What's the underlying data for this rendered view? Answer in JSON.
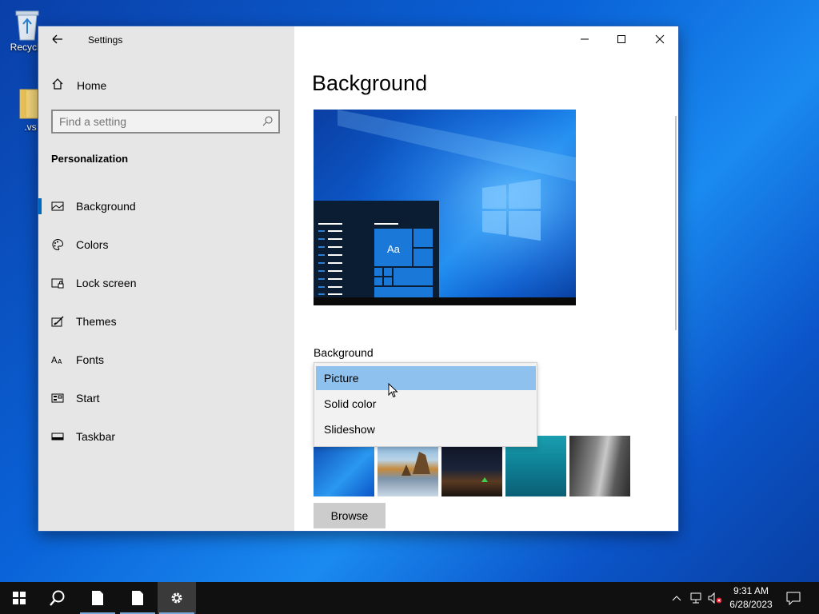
{
  "desktop": {
    "icons": [
      {
        "label": "Recycle",
        "icon": "recycle-bin-icon"
      },
      {
        "label": ".vs",
        "icon": "folder-icon"
      }
    ]
  },
  "window": {
    "title": "Settings",
    "controls": {
      "minimize": "minimize-icon",
      "maximize": "maximize-icon",
      "close": "close-icon"
    }
  },
  "sidebar": {
    "home_label": "Home",
    "search_placeholder": "Find a setting",
    "section_title": "Personalization",
    "items": [
      {
        "label": "Background",
        "icon": "picture-icon",
        "active": true
      },
      {
        "label": "Colors",
        "icon": "palette-icon",
        "active": false
      },
      {
        "label": "Lock screen",
        "icon": "lock-screen-icon",
        "active": false
      },
      {
        "label": "Themes",
        "icon": "themes-icon",
        "active": false
      },
      {
        "label": "Fonts",
        "icon": "fonts-icon",
        "active": false
      },
      {
        "label": "Start",
        "icon": "start-icon",
        "active": false
      },
      {
        "label": "Taskbar",
        "icon": "taskbar-icon",
        "active": false
      }
    ]
  },
  "main": {
    "page_title": "Background",
    "preview": {
      "tile_text": "Aa"
    },
    "background_label": "Background",
    "dropdown_options": [
      {
        "label": "Picture",
        "selected": true
      },
      {
        "label": "Solid color",
        "selected": false
      },
      {
        "label": "Slideshow",
        "selected": false
      }
    ],
    "browse_label": "Browse"
  },
  "taskbar": {
    "time": "9:31 AM",
    "date": "6/28/2023",
    "apps": [
      "start-icon",
      "search-icon",
      "document-icon",
      "document-icon",
      "settings-gear-icon"
    ]
  },
  "colors": {
    "accent": "#0067c0",
    "selected_option": "#8fc1ee",
    "taskbar": "#101010"
  }
}
